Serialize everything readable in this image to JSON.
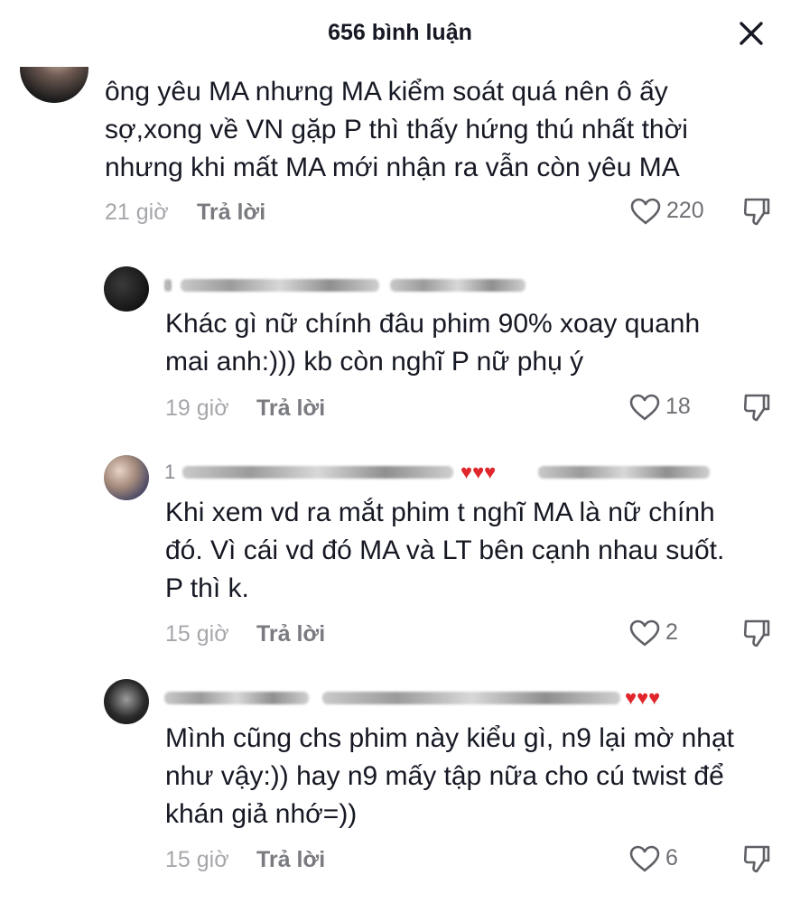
{
  "header": {
    "title": "656 bình luận"
  },
  "icons": {
    "close": "close-icon",
    "like": "heart-outline-icon",
    "dislike": "thumbs-down-icon"
  },
  "comments": [
    {
      "username": "",
      "text": "ông yêu MA nhưng MA kiểm soát quá nên ô ấy\nsợ,xong về VN gặp P thì thấy hứng thú nhất thời\nnhưng khi mất MA mới nhận ra vẫn còn yêu MA",
      "time": "21 giờ",
      "reply_label": "Trả lời",
      "likes": "220"
    },
    {
      "username": "",
      "text": "Khác gì nữ chính đâu phim 90% xoay quanh\nmai anh:))) kb còn nghĩ P nữ phụ ý",
      "time": "19 giờ",
      "reply_label": "Trả lời",
      "likes": "18"
    },
    {
      "username": "1",
      "text": "Khi xem vd ra mắt phim t nghĩ MA là nữ chính\nđó. Vì cái vd đó MA và LT bên cạnh nhau suốt.\nP thì k.",
      "time": "15 giờ",
      "reply_label": "Trả lời",
      "likes": "2"
    },
    {
      "username": "",
      "text": "Mình cũng chs phim này kiểu gì, n9 lại mờ nhạt\nnhư vậy:)) hay n9 mấy tập nữa cho cú twist để\nkhán giả nhớ=))",
      "time": "15 giờ",
      "reply_label": "Trả lời",
      "likes": "6"
    }
  ],
  "colors": {
    "text": "#161823",
    "meta": "#a6a7ab",
    "reply": "#7a7b80",
    "heart_emoji": "#e0262b"
  }
}
